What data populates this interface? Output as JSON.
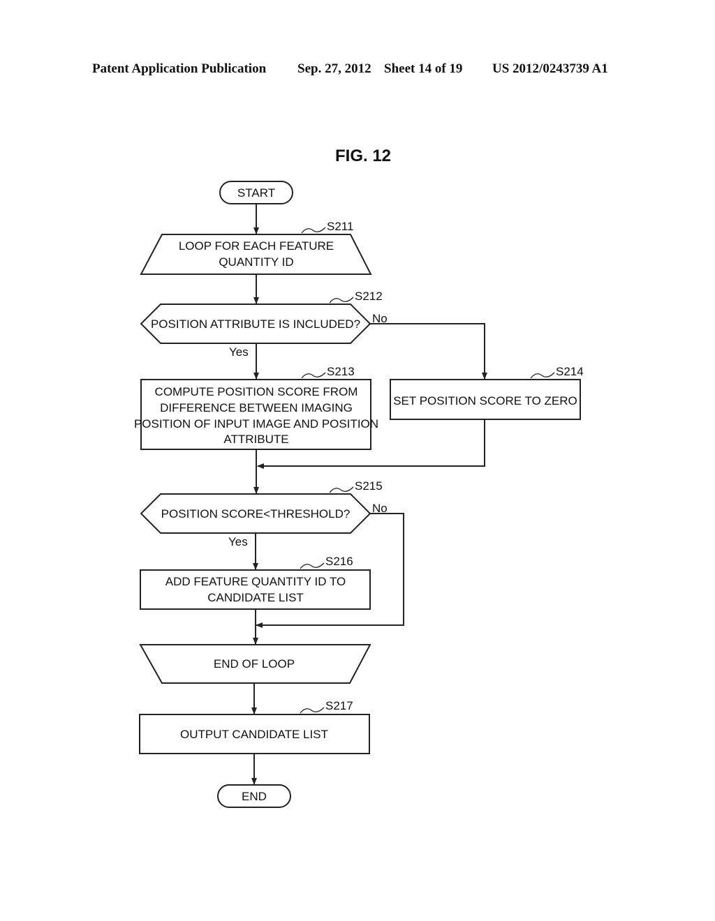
{
  "header": {
    "publication": "Patent Application Publication",
    "date": "Sep. 27, 2012",
    "sheet": "Sheet 14 of 19",
    "number": "US 2012/0243739 A1"
  },
  "figure": {
    "title": "FIG. 12"
  },
  "flowchart": {
    "start": "START",
    "end": "END",
    "steps": {
      "s211": {
        "id": "S211",
        "lines": [
          "LOOP FOR EACH FEATURE",
          "QUANTITY ID"
        ]
      },
      "s212": {
        "id": "S212",
        "lines": [
          "POSITION ATTRIBUTE IS INCLUDED?"
        ]
      },
      "s213": {
        "id": "S213",
        "lines": [
          "COMPUTE POSITION SCORE FROM",
          "DIFFERENCE BETWEEN IMAGING",
          "POSITION OF INPUT IMAGE AND POSITION",
          "ATTRIBUTE"
        ]
      },
      "s214": {
        "id": "S214",
        "lines": [
          "SET POSITION SCORE TO ZERO"
        ]
      },
      "s215": {
        "id": "S215",
        "lines": [
          "POSITION SCORE<THRESHOLD?"
        ]
      },
      "s216": {
        "id": "S216",
        "lines": [
          "ADD FEATURE QUANTITY ID TO",
          "CANDIDATE LIST"
        ]
      },
      "loop_end": {
        "lines": [
          "END OF LOOP"
        ]
      },
      "s217": {
        "id": "S217",
        "lines": [
          "OUTPUT CANDIDATE LIST"
        ]
      }
    },
    "branches": {
      "s212_yes": "Yes",
      "s212_no": "No",
      "s215_yes": "Yes",
      "s215_no": "No"
    }
  }
}
